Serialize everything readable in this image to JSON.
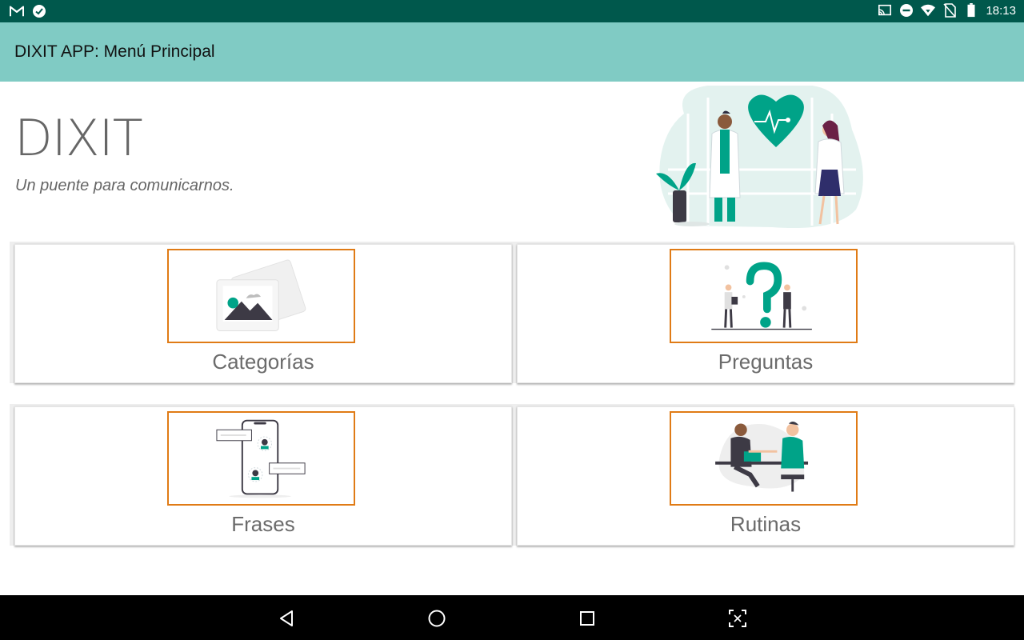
{
  "status_bar": {
    "time": "18:13",
    "left_icons": [
      "gmail-icon",
      "check-circle-icon"
    ],
    "right_icons": [
      "cast-icon",
      "do-not-disturb-icon",
      "wifi-icon",
      "no-sim-icon",
      "battery-icon"
    ]
  },
  "app_bar": {
    "title": "DIXIT APP: Menú Principal"
  },
  "header": {
    "brand": "DIXIT",
    "tagline": "Un puente para comunicarnos."
  },
  "menu": {
    "items": [
      {
        "label": "Categorías",
        "icon": "gallery-illustration"
      },
      {
        "label": "Preguntas",
        "icon": "question-illustration"
      },
      {
        "label": "Frases",
        "icon": "chat-phone-illustration"
      },
      {
        "label": "Rutinas",
        "icon": "handshake-illustration"
      }
    ]
  },
  "nav_bar": {
    "buttons": [
      "back-icon",
      "home-icon",
      "recents-icon",
      "screenshot-icon"
    ]
  },
  "colors": {
    "status_bar": "#00584c",
    "app_bar": "#80cbc4",
    "accent_teal": "#00a388",
    "thumb_border": "#e07b16",
    "text_gray": "#666666"
  }
}
